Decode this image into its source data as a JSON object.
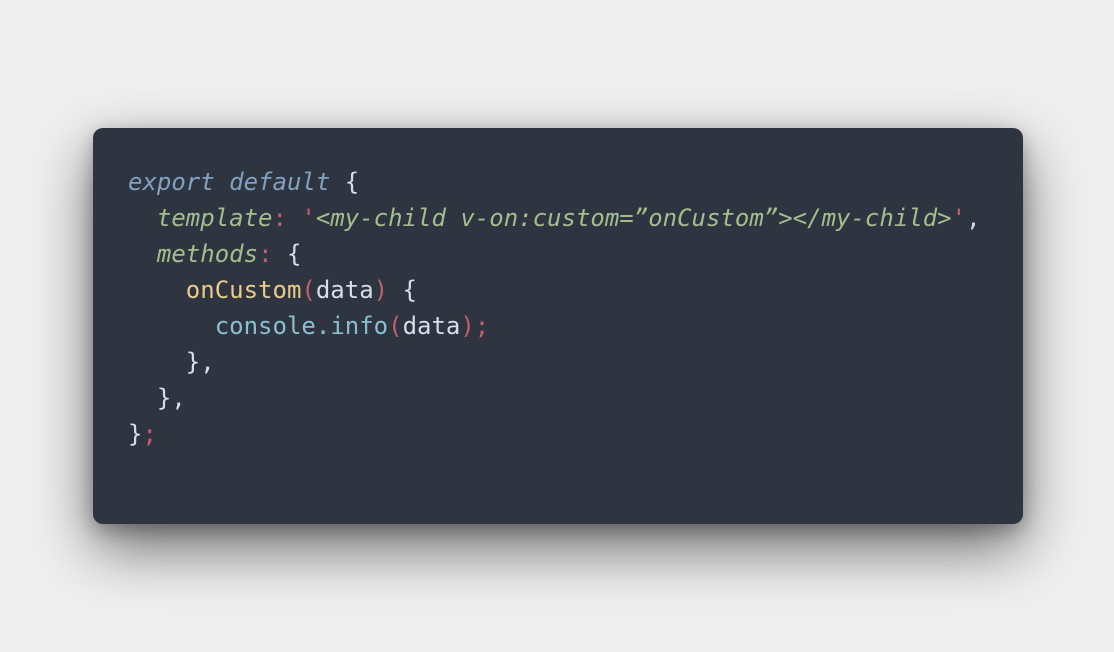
{
  "code": {
    "lines": [
      {
        "kw1": "export",
        "kw2": "default",
        "brace": "{"
      },
      {
        "prop": "template",
        "colon": ":",
        "q1": "'",
        "str": "<my-child v-on:custom=”onCustom”></my-child>",
        "q2": "'",
        "comma": ","
      },
      {
        "prop": "methods",
        "colon": ":",
        "brace": "{"
      },
      {
        "fn": "onCustom",
        "p1": "(",
        "arg": "data",
        "p2": ")",
        "brace": "{"
      },
      {
        "obj": "console",
        "dot": ".",
        "method": "info",
        "p1": "(",
        "arg": "data",
        "end": ");"
      },
      {
        "text": "},"
      },
      {
        "text": "},"
      },
      {
        "brace": "}",
        "semi": ";"
      }
    ]
  },
  "colors": {
    "background": "#efefef",
    "editor": "#2e3440",
    "keyword": "#81a1c1",
    "string": "#a3be8c",
    "punctuation": "#bf616a",
    "function": "#ebcb8b",
    "builtin": "#88c0d0",
    "text": "#d8dee9"
  }
}
